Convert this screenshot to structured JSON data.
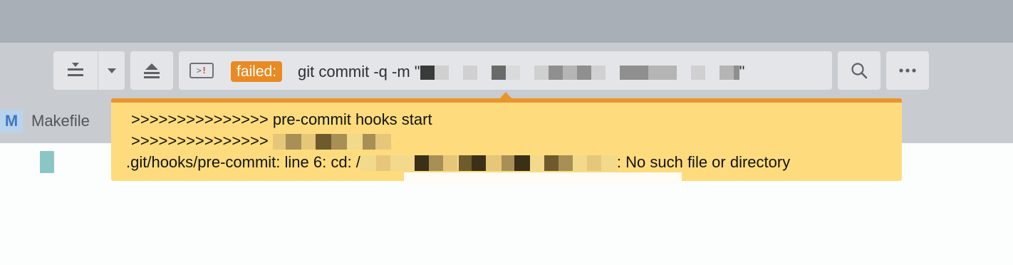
{
  "toolbar": {
    "download_icon": "download-tray-icon",
    "dropdown_icon": "chevron-down-icon",
    "eject_icon": "eject-icon",
    "terminal_icon": "terminal-error-icon",
    "terminal_glyph": ">",
    "terminal_bang": "!",
    "status_badge": "failed:",
    "command_prefix": "git commit -q -m \"",
    "command_suffix": "\"",
    "search_icon": "search-icon",
    "more_icon": "more-icon",
    "more_glyph": "•••"
  },
  "tab": {
    "icon_letter": "M",
    "label": "Makefile"
  },
  "popup": {
    "line1": ">>>>>>>>>>>>>>> pre-commit hooks start",
    "line2_prefix": ">>>>>>>>>>>>>>> ",
    "line3_prefix": ".git/hooks/pre-commit: line 6: cd: /",
    "line3_suffix": ": No such file or directory"
  },
  "colors": {
    "badge": "#e98a23",
    "popup_bg": "#fedc7d",
    "popup_border": "#e9952d"
  }
}
